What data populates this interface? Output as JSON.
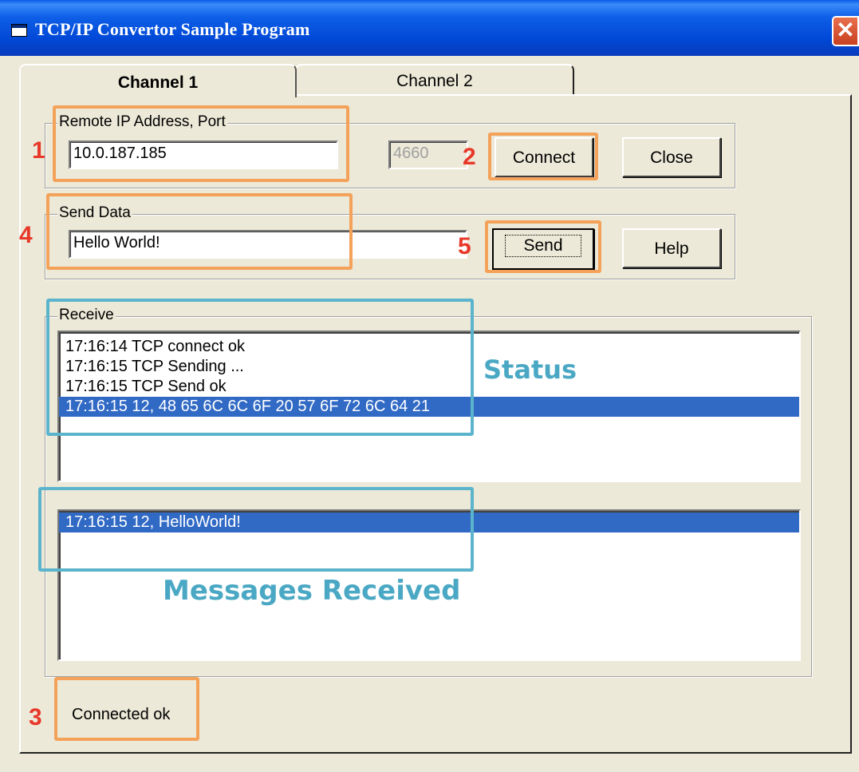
{
  "window": {
    "title": "TCP/IP Convertor Sample Program",
    "close_icon": "close-x-icon"
  },
  "tabs": [
    {
      "label": "Channel 1",
      "active": true
    },
    {
      "label": "Channel 2",
      "active": false
    }
  ],
  "remote": {
    "legend": "Remote IP Address, Port",
    "ip_value": "10.0.187.185",
    "port_value": "4660",
    "connect_label": "Connect",
    "close_label": "Close"
  },
  "send": {
    "legend": "Send Data",
    "data_value": "Hello World!",
    "send_label": "Send",
    "help_label": "Help"
  },
  "receive": {
    "legend": "Receive",
    "status_lines": [
      "17:16:14 TCP connect ok",
      "17:16:15 TCP Sending ...",
      "17:16:15 TCP Send ok",
      "17:16:15 12, 48 65 6C 6C 6F 20 57 6F 72 6C 64 21"
    ],
    "status_selected_index": 3,
    "message_lines": [
      "17:16:15 12, HelloWorld!"
    ],
    "message_selected_index": 0
  },
  "status_bar": {
    "text": "Connected ok"
  },
  "annotations": {
    "n1": "1",
    "n2": "2",
    "n3": "3",
    "n4": "4",
    "n5": "5",
    "status_label": "Status",
    "messages_label": "Messages Received",
    "orange_color": "#f4a25a",
    "teal_color": "#5bb4cc",
    "number_color": "#e8382a"
  }
}
